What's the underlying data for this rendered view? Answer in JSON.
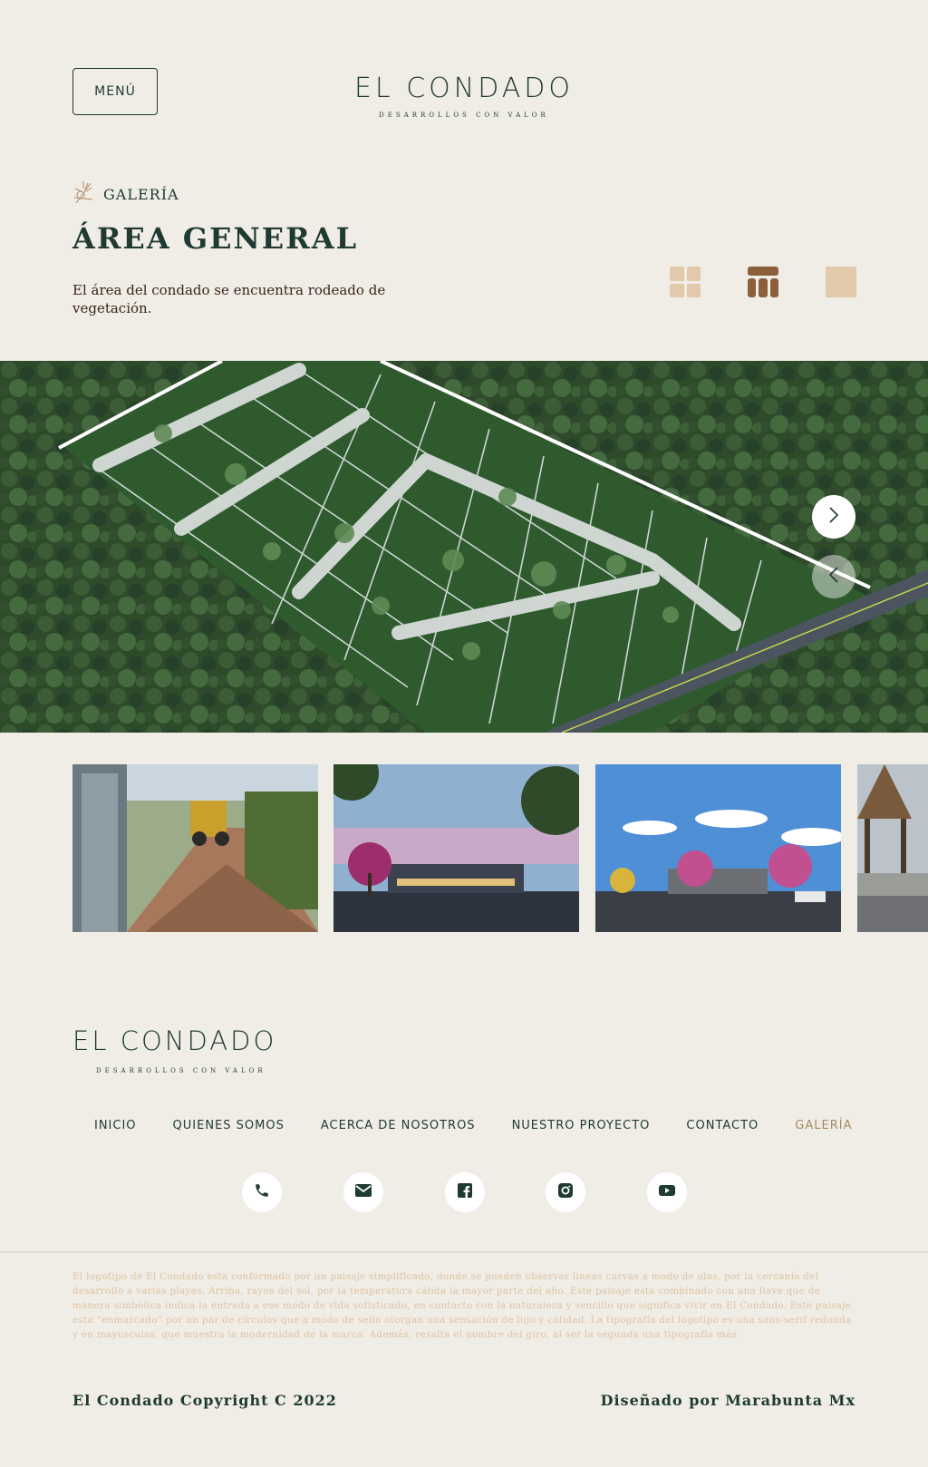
{
  "header": {
    "menu_label": "MENÚ",
    "logo_name": "EL CONDADO",
    "logo_tagline": "DESARROLLOS CON VALOR"
  },
  "gallery": {
    "section_label": "GALERÍA",
    "title": "ÁREA GENERAL",
    "description": "El área del condado se encuentra rodeado de vegetación.",
    "view_options": [
      "grid-view-icon",
      "mixed-view-icon",
      "single-view-icon"
    ],
    "active_view": "mixed-view-icon"
  },
  "footer": {
    "logo_name": "EL CONDADO",
    "logo_tagline": "DESARROLLOS CON VALOR",
    "nav": [
      {
        "label": "INICIO"
      },
      {
        "label": "QUIENES SOMOS"
      },
      {
        "label": "ACERCA DE NOSOTROS"
      },
      {
        "label": "NUESTRO PROYECTO"
      },
      {
        "label": "CONTACTO"
      },
      {
        "label": "GALERÍA",
        "active": true
      }
    ],
    "social": [
      "phone-icon",
      "mail-icon",
      "facebook-icon",
      "instagram-icon",
      "youtube-icon"
    ],
    "legal_text": "El logotipo de El Condado esta conformado por un paisaje simplificado, donde se pueden observar lineas curvas a modo de olas, por la cercanía del desarrollo a varias playas. Arriba, rayos del sol, por la temperatura cálida la mayor parte del año. Este paisaje esta combinado con una llave que de manera simbólica indica la entrada a ese modo de vida sofisticado, en contacto con la naturaleza y sencillo que significa vivir en El Condado. Este paisaje esta “enmarcado” por un par de círculos que a modo de sello otorgan una sensación de lujo y cálidad. La tipografía del logotipo es una sans-serif redonda y en mayusculas, que muestra la modernidad de la marca. Además, resalta el nombre del giro, al ser la segunda una tipografía más",
    "copyright": "El Condado Copyright C 2022",
    "credit": "Diseñado por Marabunta Mx"
  },
  "colors": {
    "background": "#f0ede6",
    "brand_green": "#1e3a31",
    "accent_tan": "#e3c9ab",
    "accent_brown": "#8b5e3c",
    "active_link": "#a88a62"
  }
}
